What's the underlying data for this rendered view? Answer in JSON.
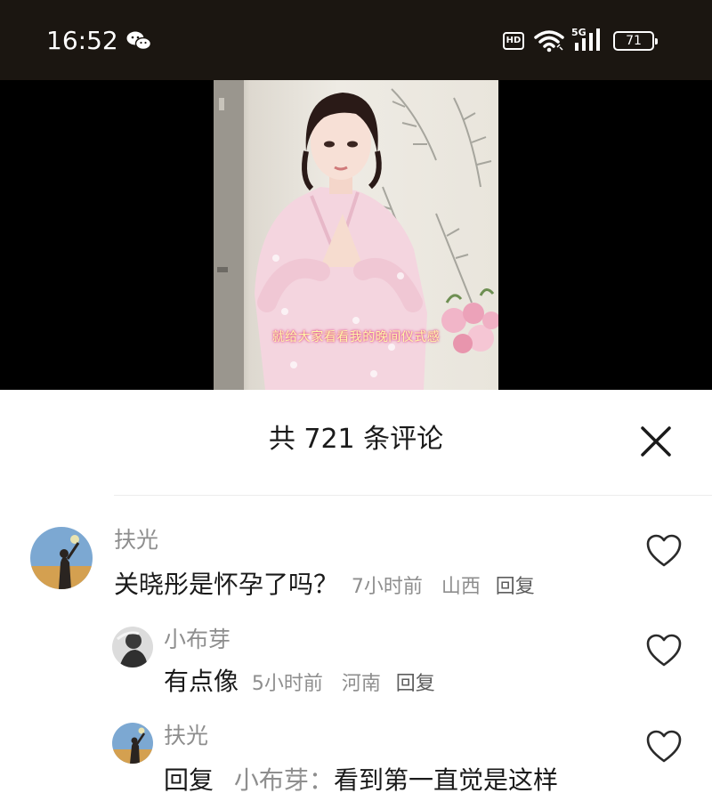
{
  "status_bar": {
    "time": "16:52",
    "hd": "HD",
    "network": "5G",
    "battery": "71",
    "icons": [
      "wechat-icon",
      "wifi-icon",
      "signal-icon",
      "battery-icon"
    ]
  },
  "video": {
    "caption": "就给大家看看我的晚间仪式感"
  },
  "comments_panel": {
    "title": "共 721 条评论",
    "comments": [
      {
        "author": "扶光",
        "text": "关晓彤是怀孕了吗？",
        "time": "7小时前",
        "location": "山西",
        "reply_label": "回复"
      },
      {
        "author": "小布芽",
        "text": "有点像",
        "time": "5小时前",
        "location": "河南",
        "reply_label": "回复"
      },
      {
        "author": "扶光",
        "reply_prefix": "回复",
        "reply_to": "小布芽",
        "text": "看到第一直觉是这样"
      }
    ]
  },
  "colors": {
    "status_bg": "#1b1611",
    "video_bg": "#000000",
    "caption": "#fff7a8",
    "text_primary": "#1a1a1a",
    "text_secondary": "#8e8e8e"
  }
}
